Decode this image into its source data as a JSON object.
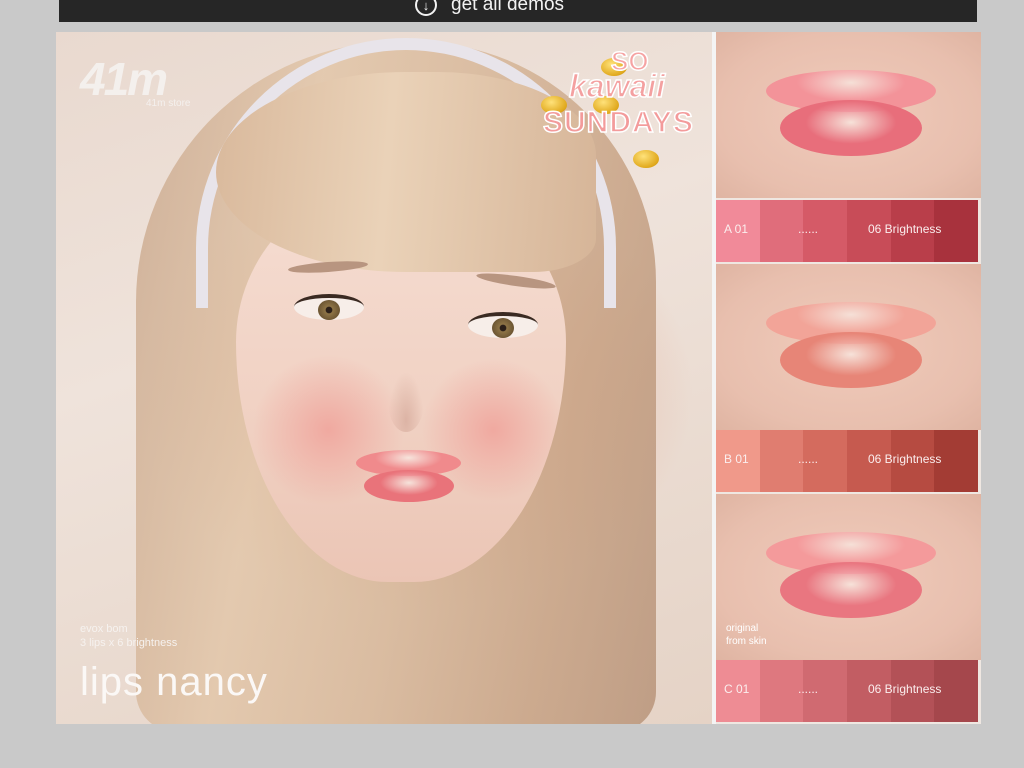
{
  "topbar": {
    "download_label": "get all demos"
  },
  "poster": {
    "store_label": "41m store",
    "brand_logo_text": "41m",
    "badge": {
      "so": "SO",
      "kawaii": "kawaii",
      "sundays": "SUNDAYS"
    },
    "info_line1": "evox bom",
    "info_line2": "3 lips x 6 brightness",
    "product_name": "lips nancy",
    "original_note_line1": "original",
    "original_note_line2": "from skin"
  },
  "swatches": [
    {
      "label": "A 01",
      "dots": "......",
      "brightness": "06 Brightness",
      "colors": [
        "#f18a99",
        "#e06d7b",
        "#d55a67",
        "#c84c58",
        "#b93e4a",
        "#a8323d"
      ]
    },
    {
      "label": "B 01",
      "dots": "......",
      "brightness": "06 Brightness",
      "colors": [
        "#f0998a",
        "#e07d70",
        "#d46b5e",
        "#c65a4f",
        "#b64b41",
        "#a33c34"
      ]
    },
    {
      "label": "C 01",
      "dots": "......",
      "brightness": "06 Brightness",
      "colors": [
        "#ee8c94",
        "#de787f",
        "#d06a71",
        "#c25d63",
        "#b35157",
        "#a5474c"
      ]
    }
  ],
  "lip_colors": {
    "main": [
      "#f08a8c",
      "#e9737a"
    ],
    "a": [
      "#f39399",
      "#e86e7b"
    ],
    "b": [
      "#f2a498",
      "#e78577"
    ],
    "c": [
      "#f49a9b",
      "#e97680"
    ]
  }
}
